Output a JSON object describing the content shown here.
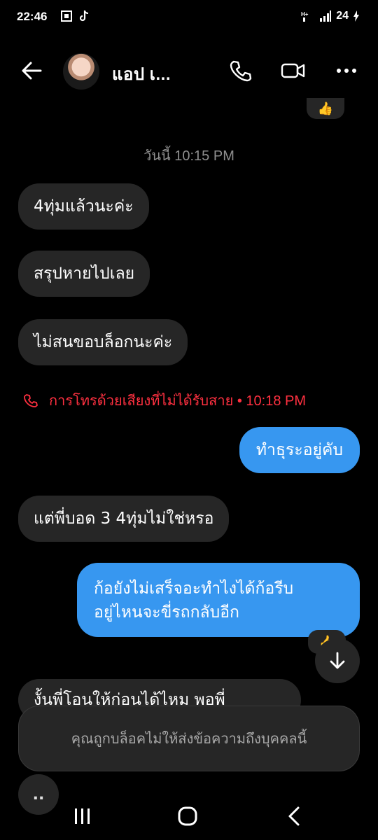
{
  "status_bar": {
    "time": "22:46",
    "battery": "24"
  },
  "header": {
    "contact_name": "แอป เ...",
    "icons": [
      "back-arrow-icon",
      "phone-icon",
      "video-camera-icon",
      "more-icon"
    ]
  },
  "day_label": "วันนี้ 10:15 PM",
  "messages": [
    {
      "text": "4ทุ่มแล้วนะค่ะ",
      "dir": "in"
    },
    {
      "text": "สรุปหายไปเลย",
      "dir": "in"
    },
    {
      "text": "ไม่สนขอบล็อกนะค่ะ",
      "dir": "in"
    },
    {
      "text": "ทำธุระอยู่คับ",
      "dir": "out"
    },
    {
      "text": "แต่พี่บอด 3 4ทุ่มไม่ใช่หรอ",
      "dir": "in"
    },
    {
      "text_line1": "ก้อยังไม่เสร็จอะทำไงได้ก้อรีบ",
      "text_line2": "อยู่ไหนจะขี่รถกลับอีก",
      "dir": "out"
    },
    {
      "text": "งั้นพี่โอนให้ก่อนได้ไหม พอพี่",
      "dir": "in"
    }
  ],
  "missed_call": "การโทรด้วยเสียงที่ไม่ได้รับสาย • 10:18 PM",
  "reaction": "👍",
  "blocked_notice": "คุณถูกบล็อคไม่ให้ส่งข้อความถึงบุคคลนี้",
  "typing_indicator": "..",
  "colors": {
    "background": "#000000",
    "incoming": "#262626",
    "outgoing": "#3797f0",
    "missed": "#ff3040"
  }
}
